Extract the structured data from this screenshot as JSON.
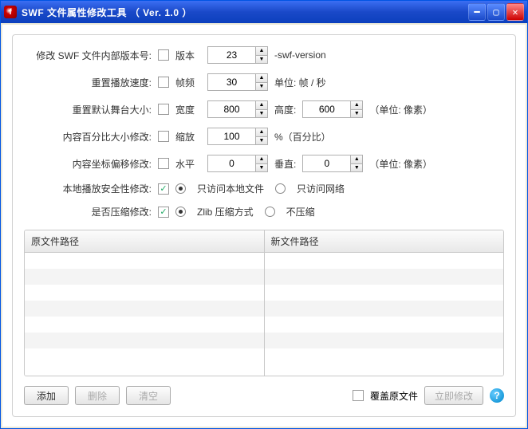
{
  "titlebar": {
    "title": "SWF 文件属性修改工具 （ Ver. 1.0 ）"
  },
  "form": {
    "version": {
      "label": "修改 SWF 文件内部版本号:",
      "enabled": false,
      "field_label": "版本",
      "value": "23",
      "suffix": "-swf-version"
    },
    "framerate": {
      "label": "重置播放速度:",
      "enabled": false,
      "field_label": "帧频",
      "value": "30",
      "suffix": "单位: 帧 / 秒"
    },
    "stage": {
      "label": "重置默认舞台大小:",
      "enabled": false,
      "w_label": "宽度",
      "w_value": "800",
      "h_label": "高度:",
      "h_value": "600",
      "suffix": "（单位: 像素）"
    },
    "scale": {
      "label": "内容百分比大小修改:",
      "enabled": false,
      "field_label": "缩放",
      "value": "100",
      "suffix": "%（百分比）"
    },
    "offset": {
      "label": "内容坐标偏移修改:",
      "enabled": false,
      "h_label": "水平",
      "h_value": "0",
      "v_label": "垂直:",
      "v_value": "0",
      "suffix": "（单位: 像素）"
    },
    "security": {
      "label": "本地播放安全性修改:",
      "enabled": true,
      "option_local": "只访问本地文件",
      "option_network": "只访问网络",
      "selected": "local"
    },
    "compress": {
      "label": "是否压缩修改:",
      "enabled": true,
      "option_zlib": "Zlib 压缩方式",
      "option_none": "不压缩",
      "selected": "zlib"
    }
  },
  "grid": {
    "col1_header": "原文件路径",
    "col2_header": "新文件路径",
    "rows": []
  },
  "footer": {
    "add": "添加",
    "delete": "删除",
    "clear": "清空",
    "overwrite_checked": false,
    "overwrite_label": "覆盖原文件",
    "apply": "立即修改"
  }
}
